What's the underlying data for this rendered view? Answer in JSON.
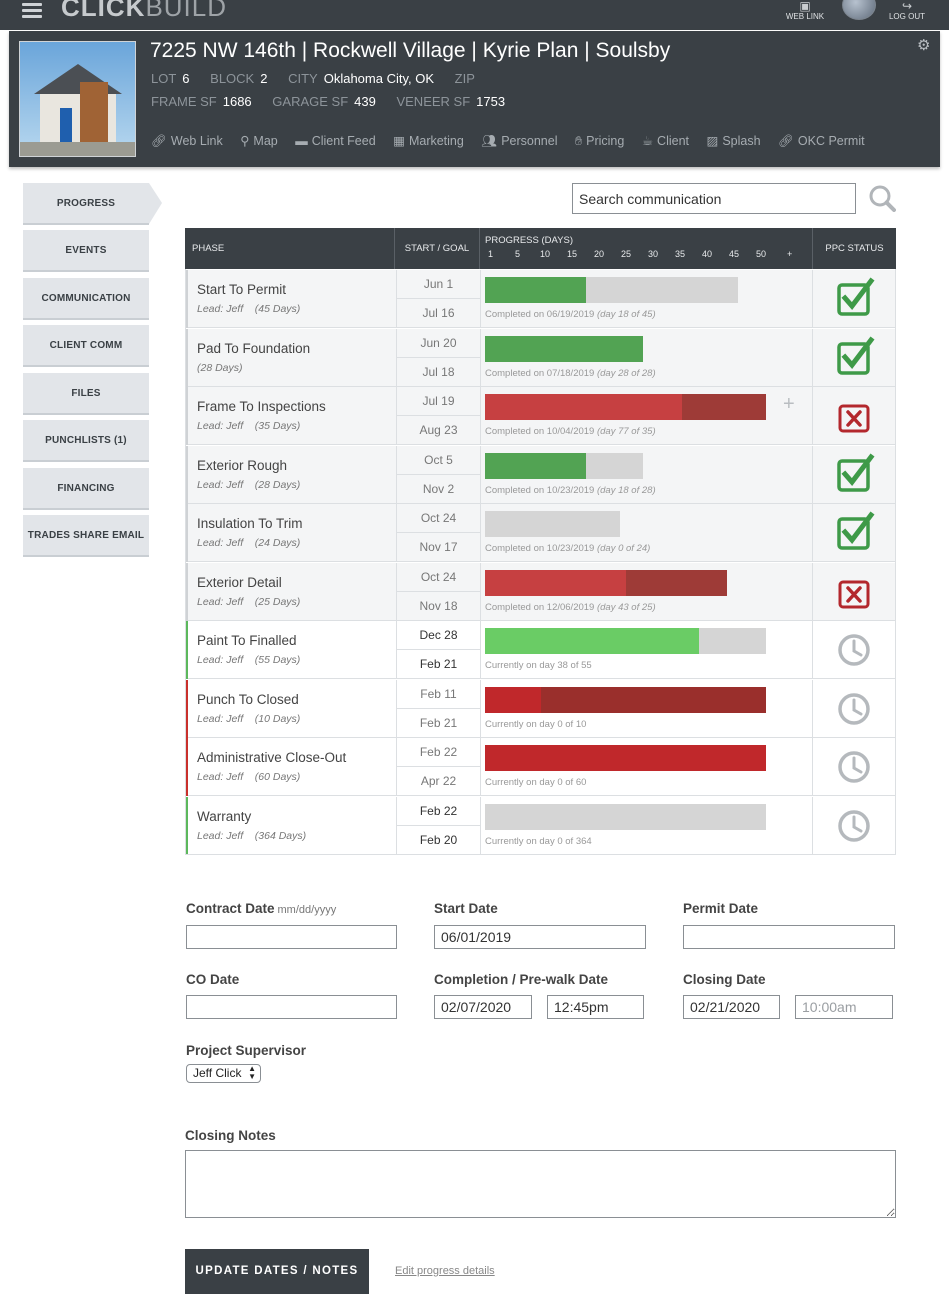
{
  "app": {
    "logo_bold": "CLICK",
    "logo_light": "BUILD",
    "web_link": "WEB LINK",
    "log_out": "LOG OUT"
  },
  "project": {
    "title": "7225 NW 146th | Rockwell Village | Kyrie Plan | Soulsby",
    "lot_label": "LOT",
    "lot": "6",
    "block_label": "BLOCK",
    "block": "2",
    "city_label": "CITY",
    "city": "Oklahoma City, OK",
    "zip_label": "ZIP",
    "frame_label": "FRAME SF",
    "frame": "1686",
    "garage_label": "GARAGE SF",
    "garage": "439",
    "veneer_label": "VENEER SF",
    "veneer": "1753",
    "links": [
      "Web Link",
      "Map",
      "Client Feed",
      "Marketing",
      "Personnel",
      "Pricing",
      "Client",
      "Splash",
      "OKC Permit"
    ]
  },
  "sidebar": [
    "PROGRESS",
    "EVENTS",
    "COMMUNICATION",
    "CLIENT COMM",
    "FILES",
    "PUNCHLISTS (1)",
    "FINANCING",
    "TRADES SHARE EMAIL"
  ],
  "search": {
    "placeholder": "Search communication"
  },
  "table": {
    "headers": {
      "phase": "PHASE",
      "dates": "START / GOAL",
      "progress": "PROGRESS (DAYS)",
      "status": "PPC STATUS"
    },
    "ticks": [
      "1",
      "5",
      "10",
      "15",
      "20",
      "25",
      "30",
      "35",
      "40",
      "45",
      "50",
      "+"
    ],
    "rows": [
      {
        "name": "Start To Permit",
        "lead": "Lead: Jeff",
        "days": "(45 Days)",
        "start": "Jun 1",
        "goal": "Jul 16",
        "text": "Completed on 06/19/2019",
        "detail": "(day 18 of 45)"
      },
      {
        "name": "Pad To Foundation",
        "lead": "",
        "days": "(28 Days)",
        "start": "Jun 20",
        "goal": "Jul 18",
        "text": "Completed on 07/18/2019",
        "detail": "(day 28 of 28)"
      },
      {
        "name": "Frame To Inspections",
        "lead": "Lead: Jeff",
        "days": "(35 Days)",
        "start": "Jul 19",
        "goal": "Aug 23",
        "text": "Completed on 10/04/2019",
        "detail": "(day 77 of 35)"
      },
      {
        "name": "Exterior Rough",
        "lead": "Lead: Jeff",
        "days": "(28 Days)",
        "start": "Oct 5",
        "goal": "Nov 2",
        "text": "Completed on 10/23/2019",
        "detail": "(day 18 of 28)"
      },
      {
        "name": "Insulation To Trim",
        "lead": "Lead: Jeff",
        "days": "(24 Days)",
        "start": "Oct 24",
        "goal": "Nov 17",
        "text": "Completed on 10/23/2019",
        "detail": "(day 0 of 24)"
      },
      {
        "name": "Exterior Detail",
        "lead": "Lead: Jeff",
        "days": "(25 Days)",
        "start": "Oct 24",
        "goal": "Nov 18",
        "text": "Completed on 12/06/2019",
        "detail": "(day 43 of 25)"
      },
      {
        "name": "Paint To Finalled",
        "lead": "Lead: Jeff",
        "days": "(55 Days)",
        "start": "Dec 28",
        "goal": "Feb 21",
        "text": "Currently on day 38 of 55",
        "detail": ""
      },
      {
        "name": "Punch To Closed",
        "lead": "Lead: Jeff",
        "days": "(10 Days)",
        "start": "Feb 11",
        "goal": "Feb 21",
        "text": "Currently on day 0 of 10",
        "detail": ""
      },
      {
        "name": "Administrative Close-Out",
        "lead": "Lead: Jeff",
        "days": "(60 Days)",
        "start": "Feb 22",
        "goal": "Apr 22",
        "text": "Currently on day 0 of 60",
        "detail": ""
      },
      {
        "name": "Warranty",
        "lead": "Lead: Jeff",
        "days": "(364 Days)",
        "start": "Feb 22",
        "goal": "Feb 20",
        "text": "Currently on day 0 of 364",
        "detail": ""
      }
    ]
  },
  "form": {
    "contract_date_label": "Contract Date",
    "contract_date_hint": "mm/dd/yyyy",
    "contract_date": "",
    "start_date_label": "Start Date",
    "start_date": "06/01/2019",
    "permit_date_label": "Permit Date",
    "permit_date": "",
    "co_date_label": "CO Date",
    "co_date": "",
    "completion_label": "Completion / Pre-walk Date",
    "completion_date": "02/07/2020",
    "completion_time": "12:45pm",
    "closing_label": "Closing Date",
    "closing_date": "02/21/2020",
    "closing_time_placeholder": "10:00am",
    "supervisor_label": "Project Supervisor",
    "supervisor": "Jeff Click",
    "notes_label": "Closing Notes",
    "update_button": "UPDATE DATES / NOTES",
    "edit_link": "Edit progress details"
  },
  "colors": {
    "dark": "#3a4045",
    "green": "#52a353",
    "bright_green": "#6acc65",
    "red": "#c64041",
    "dark_red": "#9e3b37",
    "gray_bar": "#d5d5d5",
    "status_green": "#3e9a48",
    "status_red": "#b3282d",
    "clock": "#b5b9bd"
  }
}
